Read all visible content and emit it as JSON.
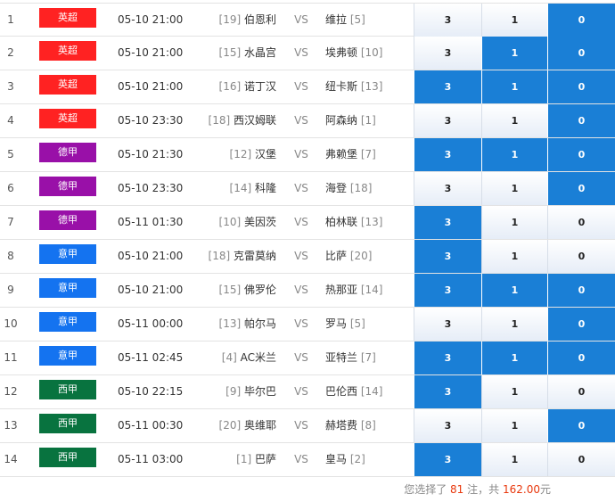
{
  "colors": {
    "epl": "#ff2222",
    "bundesliga": "#9910a8",
    "serie_a": "#1473f0",
    "la_liga": "#08733f",
    "selected": "#1a7fd6"
  },
  "matches": [
    {
      "idx": "1",
      "league": "英超",
      "league_color": "#ff2222",
      "time": "05-10 21:00",
      "home_rank": "[19]",
      "home": "伯恩利",
      "vs": "VS",
      "away": "维拉",
      "away_rank": "[5]",
      "odds": [
        "3",
        "1",
        "0"
      ],
      "selected": [
        false,
        false,
        true
      ]
    },
    {
      "idx": "2",
      "league": "英超",
      "league_color": "#ff2222",
      "time": "05-10 21:00",
      "home_rank": "[15]",
      "home": "水晶宫",
      "vs": "VS",
      "away": "埃弗顿",
      "away_rank": "[10]",
      "odds": [
        "3",
        "1",
        "0"
      ],
      "selected": [
        false,
        true,
        true
      ]
    },
    {
      "idx": "3",
      "league": "英超",
      "league_color": "#ff2222",
      "time": "05-10 21:00",
      "home_rank": "[16]",
      "home": "诺丁汉",
      "vs": "VS",
      "away": "纽卡斯",
      "away_rank": "[13]",
      "odds": [
        "3",
        "1",
        "0"
      ],
      "selected": [
        true,
        true,
        true
      ]
    },
    {
      "idx": "4",
      "league": "英超",
      "league_color": "#ff2222",
      "time": "05-10 23:30",
      "home_rank": "[18]",
      "home": "西汉姆联",
      "vs": "VS",
      "away": "阿森纳",
      "away_rank": "[1]",
      "odds": [
        "3",
        "1",
        "0"
      ],
      "selected": [
        false,
        false,
        true
      ]
    },
    {
      "idx": "5",
      "league": "德甲",
      "league_color": "#9910a8",
      "time": "05-10 21:30",
      "home_rank": "[12]",
      "home": "汉堡",
      "vs": "VS",
      "away": "弗赖堡",
      "away_rank": "[7]",
      "odds": [
        "3",
        "1",
        "0"
      ],
      "selected": [
        true,
        true,
        true
      ]
    },
    {
      "idx": "6",
      "league": "德甲",
      "league_color": "#9910a8",
      "time": "05-10 23:30",
      "home_rank": "[14]",
      "home": "科隆",
      "vs": "VS",
      "away": "海登",
      "away_rank": "[18]",
      "odds": [
        "3",
        "1",
        "0"
      ],
      "selected": [
        false,
        false,
        true
      ]
    },
    {
      "idx": "7",
      "league": "德甲",
      "league_color": "#9910a8",
      "time": "05-11 01:30",
      "home_rank": "[10]",
      "home": "美因茨",
      "vs": "VS",
      "away": "柏林联",
      "away_rank": "[13]",
      "odds": [
        "3",
        "1",
        "0"
      ],
      "selected": [
        true,
        false,
        false
      ]
    },
    {
      "idx": "8",
      "league": "意甲",
      "league_color": "#1473f0",
      "time": "05-10 21:00",
      "home_rank": "[18]",
      "home": "克雷莫纳",
      "vs": "VS",
      "away": "比萨",
      "away_rank": "[20]",
      "odds": [
        "3",
        "1",
        "0"
      ],
      "selected": [
        true,
        false,
        false
      ]
    },
    {
      "idx": "9",
      "league": "意甲",
      "league_color": "#1473f0",
      "time": "05-10 21:00",
      "home_rank": "[15]",
      "home": "佛罗伦",
      "vs": "VS",
      "away": "热那亚",
      "away_rank": "[14]",
      "odds": [
        "3",
        "1",
        "0"
      ],
      "selected": [
        true,
        true,
        true
      ]
    },
    {
      "idx": "10",
      "league": "意甲",
      "league_color": "#1473f0",
      "time": "05-11 00:00",
      "home_rank": "[13]",
      "home": "帕尔马",
      "vs": "VS",
      "away": "罗马",
      "away_rank": "[5]",
      "odds": [
        "3",
        "1",
        "0"
      ],
      "selected": [
        false,
        false,
        true
      ]
    },
    {
      "idx": "11",
      "league": "意甲",
      "league_color": "#1473f0",
      "time": "05-11 02:45",
      "home_rank": "[4]",
      "home": "AC米兰",
      "vs": "VS",
      "away": "亚特兰",
      "away_rank": "[7]",
      "odds": [
        "3",
        "1",
        "0"
      ],
      "selected": [
        true,
        true,
        true
      ]
    },
    {
      "idx": "12",
      "league": "西甲",
      "league_color": "#08733f",
      "time": "05-10 22:15",
      "home_rank": "[9]",
      "home": "毕尔巴",
      "vs": "VS",
      "away": "巴伦西",
      "away_rank": "[14]",
      "odds": [
        "3",
        "1",
        "0"
      ],
      "selected": [
        true,
        false,
        false
      ]
    },
    {
      "idx": "13",
      "league": "西甲",
      "league_color": "#08733f",
      "time": "05-11 00:30",
      "home_rank": "[20]",
      "home": "奥维耶",
      "vs": "VS",
      "away": "赫塔费",
      "away_rank": "[8]",
      "odds": [
        "3",
        "1",
        "0"
      ],
      "selected": [
        false,
        false,
        true
      ]
    },
    {
      "idx": "14",
      "league": "西甲",
      "league_color": "#08733f",
      "time": "05-11 03:00",
      "home_rank": "[1]",
      "home": "巴萨",
      "vs": "VS",
      "away": "皇马",
      "away_rank": "[2]",
      "odds": [
        "3",
        "1",
        "0"
      ],
      "selected": [
        true,
        false,
        false
      ]
    }
  ],
  "summary": {
    "prefix": "您选择了",
    "count": "81",
    "mid": "注，共",
    "amount": "162.00",
    "suffix": "元"
  }
}
